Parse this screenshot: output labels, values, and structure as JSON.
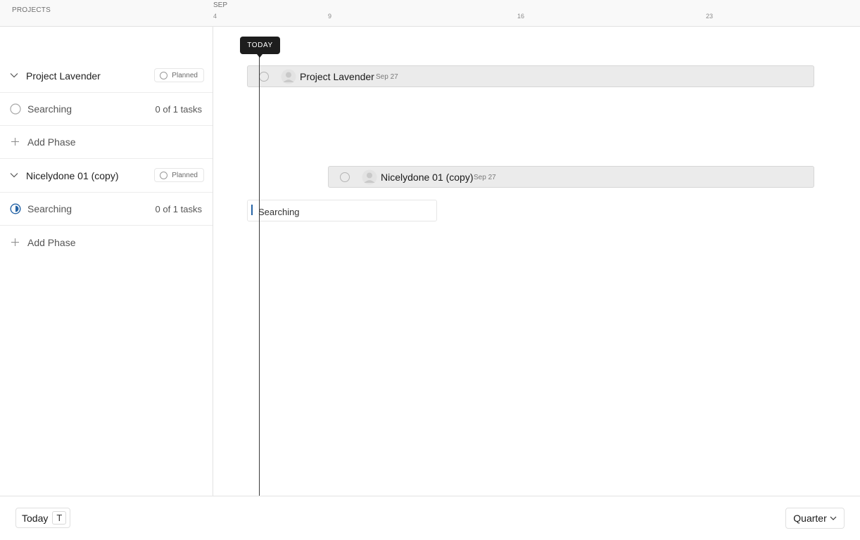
{
  "header": {
    "projects_label": "PROJECTS",
    "month": "SEP",
    "days": [
      "4",
      "9",
      "16",
      "23"
    ]
  },
  "sidebar": {
    "groups": [
      {
        "project": {
          "name": "Project Lavender",
          "status": "Planned"
        },
        "phases": [
          {
            "name": "Searching",
            "tasks": "0 of 1 tasks",
            "state": "empty"
          }
        ],
        "add_phase_label": "Add Phase"
      },
      {
        "project": {
          "name": "Nicelydone 01 (copy)",
          "status": "Planned"
        },
        "phases": [
          {
            "name": "Searching",
            "tasks": "0 of 1 tasks",
            "state": "in-progress"
          }
        ],
        "add_phase_label": "Add Phase"
      }
    ]
  },
  "timeline": {
    "today_marker": "TODAY",
    "bars": [
      {
        "name": "Project Lavender",
        "date": "Sep 27"
      },
      {
        "name": "Nicelydone 01 (copy)",
        "date": "Sep 27"
      }
    ],
    "phase_input": {
      "value": "Searching",
      "placeholder": "Searching"
    }
  },
  "footer": {
    "today_label": "Today",
    "today_shortcut": "T",
    "view_label": "Quarter"
  },
  "colors": {
    "accent": "#2563a5",
    "today_marker": "#1d1d1d",
    "bar_fill": "#ebebeb"
  },
  "icons": [
    "chevron-down-icon",
    "status-circle-icon",
    "plus-icon",
    "avatar-icon"
  ]
}
